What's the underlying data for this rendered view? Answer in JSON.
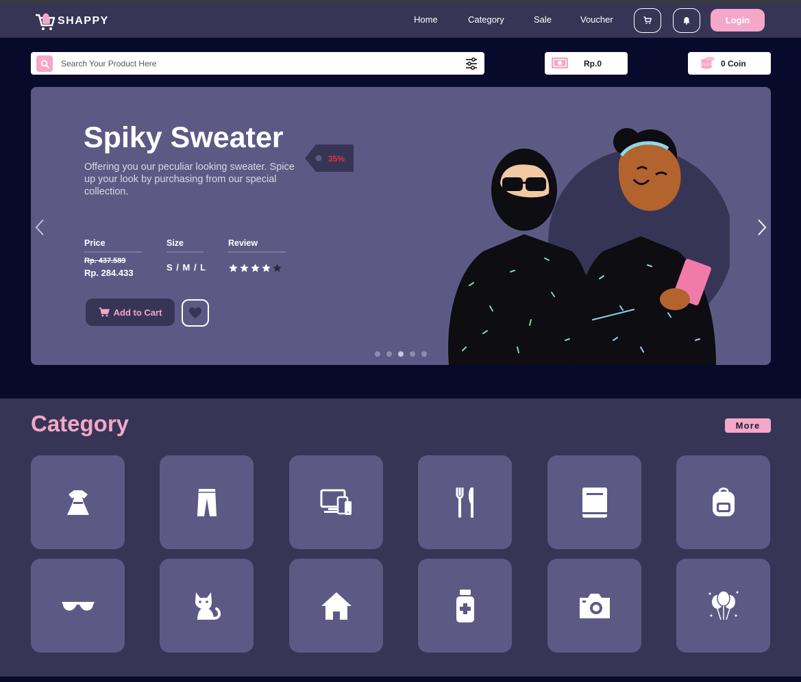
{
  "brand": {
    "name": "SHAPPY",
    "logo_icon": "shopping-cart-icon"
  },
  "nav": {
    "links": [
      "Home",
      "Category",
      "Sale",
      "Voucher"
    ],
    "cart_icon": "cart-icon",
    "bell_icon": "bell-icon",
    "login_label": "Login"
  },
  "search": {
    "placeholder": "Search Your Product Here",
    "value": ""
  },
  "wallet": {
    "balance": "Rp.0",
    "coin": "0 Coin"
  },
  "hero": {
    "title": "Spiky Sweater",
    "description": "Offering you our peculiar looking sweater. Spice up your look by purchasing from our special collection.",
    "discount": "35%",
    "price_label": "Price",
    "size_label": "Size",
    "review_label": "Review",
    "old_price": "Rp. 437.589",
    "new_price": "Rp. 284.433",
    "sizes": "S / M / L",
    "rating": 4,
    "rating_max": 5,
    "add_to_cart_label": "Add to Cart",
    "slide_count": 5,
    "active_slide": 3
  },
  "category": {
    "title": "Category",
    "more_label": "More",
    "items": [
      "dress-icon",
      "pants-icon",
      "devices-icon",
      "utensils-icon",
      "book-icon",
      "backpack-icon",
      "sunglasses-icon",
      "cat-icon",
      "home-icon",
      "medicine-icon",
      "camera-icon",
      "balloons-icon"
    ]
  },
  "colors": {
    "accent": "#f4a7c8",
    "navbar": "#373556",
    "page_bg": "#080a2c",
    "card": "#5c5a85",
    "discount_text": "#e03040"
  }
}
